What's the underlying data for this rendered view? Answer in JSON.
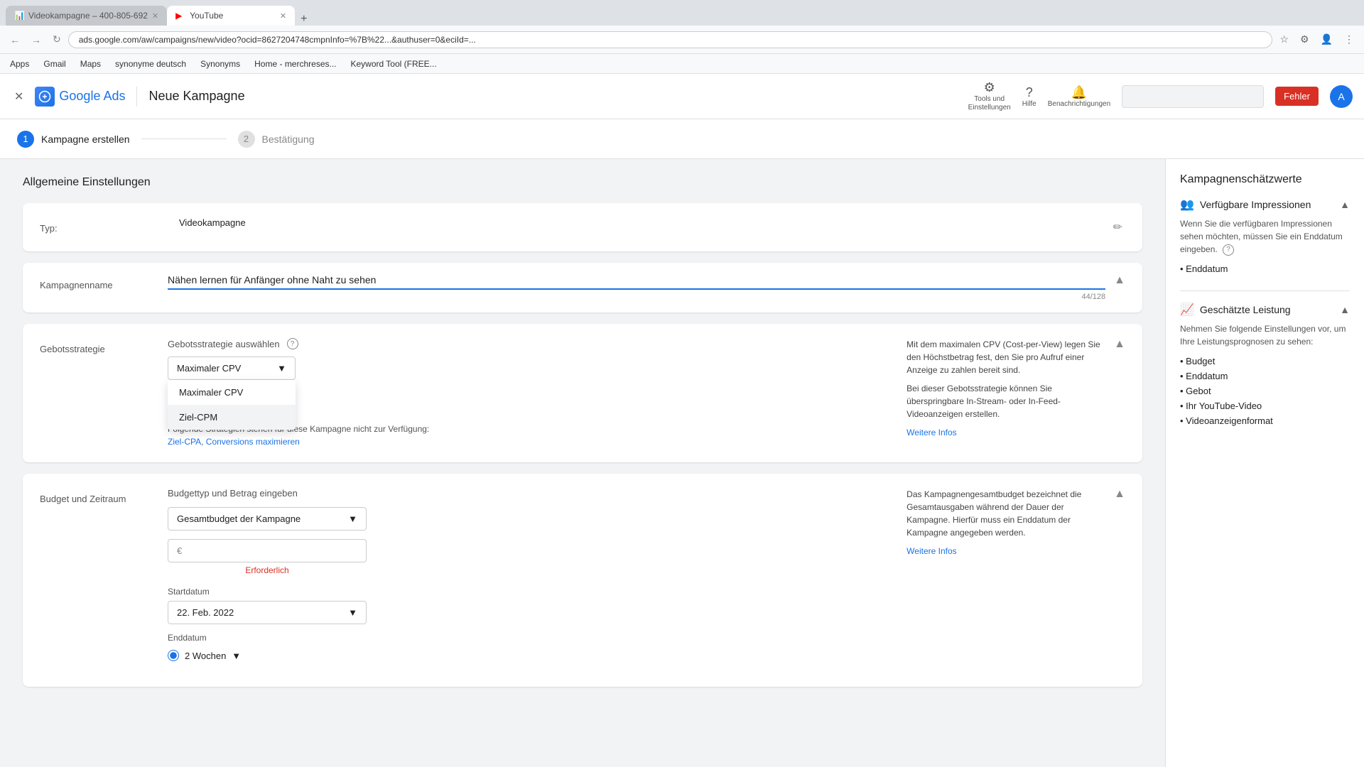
{
  "browser": {
    "tabs": [
      {
        "id": "tab1",
        "title": "Videokampagne – 400-805-692",
        "favicon": "📊",
        "active": false
      },
      {
        "id": "tab2",
        "title": "YouTube",
        "favicon": "▶",
        "active": true
      }
    ],
    "address": "ads.google.com/aw/campaigns/new/video?ocid=8627204748cmpnInfo=%7B%22...&authuser=0&eciId=...",
    "bookmarks": [
      {
        "label": "Apps"
      },
      {
        "label": "Gmail"
      },
      {
        "label": "Maps"
      },
      {
        "label": "synonyme deutsch"
      },
      {
        "label": "Synonyms"
      },
      {
        "label": "Home - merchreses..."
      },
      {
        "label": "Keyword Tool (FREE..."
      }
    ],
    "error_button": "Fehler"
  },
  "header": {
    "title": "Neue Kampagne",
    "logo_text": "Google Ads",
    "tools_label": "Tools und\nEinstellungen",
    "help_label": "Hilfe",
    "notifications_label": "Benachrichtigungen",
    "user_initial": "A"
  },
  "stepper": {
    "step1_number": "1",
    "step1_label": "Kampagne erstellen",
    "step2_number": "2",
    "step2_label": "Bestätigung"
  },
  "main": {
    "section_title": "Allgemeine Einstellungen",
    "type_card": {
      "label": "Typ:",
      "value": "Videokampagne"
    },
    "name_card": {
      "label": "Kampagnenname",
      "value": "Nähen lernen für Anfänger ohne Naht zu sehen",
      "char_count": "44/128"
    },
    "bidding_card": {
      "label": "Gebotsstrategie",
      "select_label": "Gebotsstrategie auswählen",
      "info_icon": "?",
      "dropdown_items": [
        {
          "label": "Maximaler CPV",
          "hovered": false
        },
        {
          "label": "Ziel-CPM",
          "hovered": true
        }
      ],
      "helper_text": "Folgende Strategien stehen für diese Kampagne nicht zur Verfügung:",
      "helper_links": [
        "Ziel-CPA",
        "Conversions maximieren"
      ],
      "right_title": "Mit dem maximalen CPV (Cost-per-View) legen Sie den Höchstbetrag fest, den Sie pro Aufruf einer Anzeige zu zahlen bereit sind.",
      "right_text": "Bei dieser Gebotsstrategie können Sie überspringbare In-Stream- oder In-Feed-Videoanzeigen erstellen.",
      "more_info": "Weitere Infos"
    },
    "budget_card": {
      "label": "Budget und Zeitraum",
      "budget_label": "Budgettyp und Betrag eingeben",
      "budget_select_label": "Gesamtbudget der Kampagne",
      "currency_symbol": "€",
      "required_label": "Erforderlich",
      "right_text1": "Das Kampagnengesamtbudget bezeichnet die Gesamtausgaben während der Dauer der Kampagne. Hierfür muss ein Enddatum der Kampagne angegeben werden.",
      "more_info": "Weitere Infos",
      "startdate_label": "Startdatum",
      "startdate_value": "22. Feb. 2022",
      "enddate_label": "Enddatum",
      "enddate_option": "2 Wochen"
    }
  },
  "sidebar": {
    "title": "Kampagnenschätzwerte",
    "impressions_section": {
      "title": "Verfügbare Impressionen",
      "chevron": "▲",
      "info_text": "Wenn Sie die verfügbaren Impressionen sehen möchten, müssen Sie ein Enddatum eingeben.",
      "info_icon": "?"
    },
    "list_items": [
      "Enddatum"
    ],
    "estimated_section": {
      "title": "Geschätzte Leistung",
      "chevron": "▲",
      "text": "Nehmen Sie folgende Einstellungen vor, um Ihre Leistungsprognosen zu sehen:",
      "items": [
        "Budget",
        "Enddatum",
        "Gebot",
        "Ihr YouTube-Video",
        "Videoanzeigenformat"
      ]
    }
  }
}
